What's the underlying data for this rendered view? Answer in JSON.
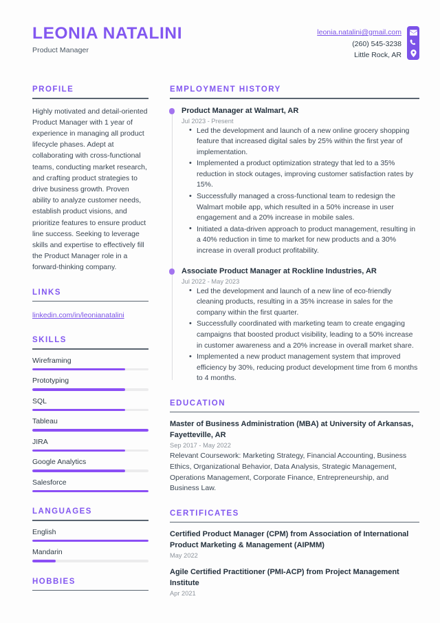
{
  "header": {
    "name": "LEONIA NATALINI",
    "role": "Product Manager",
    "contact": {
      "email": "leonia.natalini@gmail.com",
      "phone": "(260) 545-3238",
      "location": "Little Rock, AR",
      "icons": [
        "envelope-icon",
        "phone-icon",
        "location-pin-icon"
      ],
      "accent_color": "#7b52e8"
    }
  },
  "theme": {
    "accent": "#8257f0",
    "bar_fill": "#8b4ff5",
    "bar_track": "#ececed",
    "text": "#3a4653"
  },
  "left": {
    "profile": {
      "title": "PROFILE",
      "text": "Highly motivated and detail-oriented Product Manager with 1 year of experience in managing all product lifecycle phases. Adept at collaborating with cross-functional teams, conducting market research, and crafting product strategies to drive business growth. Proven ability to analyze customer needs, establish product visions, and prioritize features to ensure product line success. Seeking to leverage skills and expertise to effectively fill the Product Manager role in a forward-thinking company."
    },
    "links": {
      "title": "LINKS",
      "items": [
        {
          "label": "linkedin.com/in/leonianatalini"
        }
      ]
    },
    "skills": {
      "title": "SKILLS",
      "items": [
        {
          "label": "Wireframing",
          "level": 80
        },
        {
          "label": "Prototyping",
          "level": 80
        },
        {
          "label": "SQL",
          "level": 80
        },
        {
          "label": "Tableau",
          "level": 100
        },
        {
          "label": "JIRA",
          "level": 80
        },
        {
          "label": "Google Analytics",
          "level": 80
        },
        {
          "label": "Salesforce",
          "level": 100
        }
      ]
    },
    "languages": {
      "title": "LANGUAGES",
      "items": [
        {
          "label": "English",
          "level": 100
        },
        {
          "label": "Mandarin",
          "level": 20
        }
      ]
    },
    "hobbies": {
      "title": "HOBBIES"
    }
  },
  "right": {
    "employment": {
      "title": "EMPLOYMENT HISTORY",
      "jobs": [
        {
          "title": "Product Manager at Walmart, AR",
          "date": "Jul 2023 - Present",
          "bullets": [
            "Led the development and launch of a new online grocery shopping feature that increased digital sales by 25% within the first year of implementation.",
            "Implemented a product optimization strategy that led to a 35% reduction in stock outages, improving customer satisfaction rates by 15%.",
            "Successfully managed a cross-functional team to redesign the Walmart mobile app, which resulted in a 50% increase in user engagement and a 20% increase in mobile sales.",
            "Initiated a data-driven approach to product management, resulting in a 40% reduction in time to market for new products and a 30% increase in overall product profitability."
          ]
        },
        {
          "title": "Associate Product Manager at Rockline Industries, AR",
          "date": "Jul 2022 - May 2023",
          "bullets": [
            "Led the development and launch of a new line of eco-friendly cleaning products, resulting in a 35% increase in sales for the company within the first quarter.",
            "Successfully coordinated with marketing team to create engaging campaigns that boosted product visibility, leading to a 50% increase in customer awareness and a 20% increase in overall market share.",
            "Implemented a new product management system that improved efficiency by 30%, reducing product development time from 6 months to 4 months."
          ]
        }
      ]
    },
    "education": {
      "title": "EDUCATION",
      "entries": [
        {
          "title": "Master of Business Administration (MBA) at University of Arkansas, Fayetteville, AR",
          "date": "Sep 2017 - May 2022",
          "desc": "Relevant Coursework: Marketing Strategy, Financial Accounting, Business Ethics, Organizational Behavior, Data Analysis, Strategic Management, Operations Management, Corporate Finance, Entrepreneurship, and Business Law."
        }
      ]
    },
    "certificates": {
      "title": "CERTIFICATES",
      "entries": [
        {
          "title": "Certified Product Manager (CPM) from Association of International Product Marketing & Management (AIPMM)",
          "date": "May 2022"
        },
        {
          "title": "Agile Certified Practitioner (PMI-ACP) from Project Management Institute",
          "date": "Apr 2021"
        }
      ]
    }
  }
}
